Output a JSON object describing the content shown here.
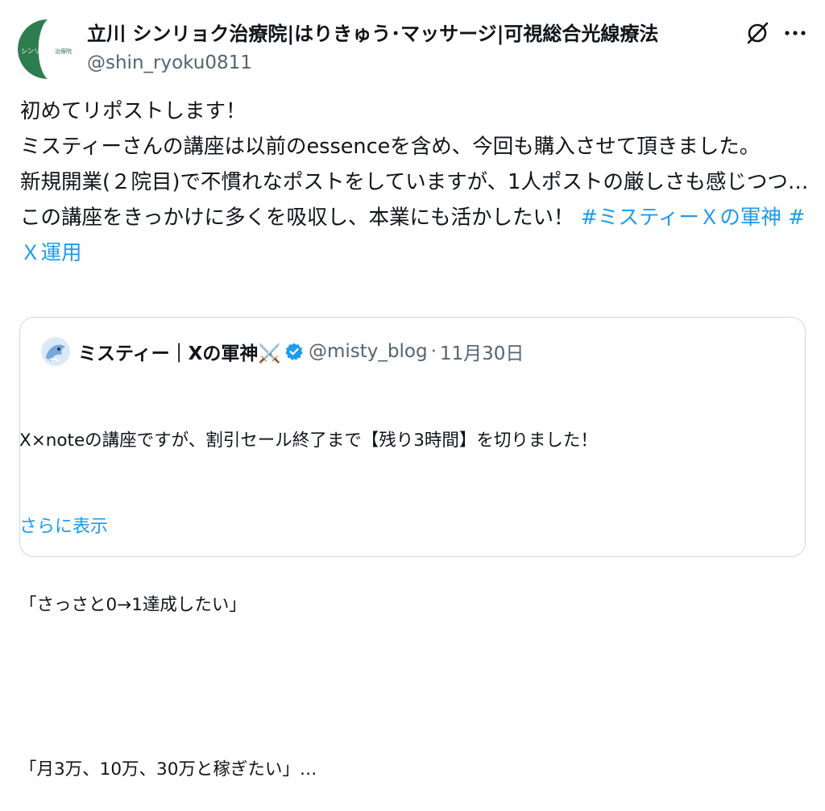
{
  "author": {
    "display_name": "立川 シンリョク治療院|はりきゅう･マッサージ|可視総合光線療法",
    "handle": "@shin_ryoku0811",
    "avatar_text": "シンリョク 治療院",
    "avatar_color": "#2e7d4f"
  },
  "post": {
    "text_main": "初めてリポストします！\nミスティーさんの講座は以前のessenceを含め、今回も購入させて頂きました。\n新規開業(２院目)で不慣れなポストをしていますが、1人ポストの厳しさも感じつつ…この講座をきっかけに多くを吸収し、本業にも活かしたい！ ",
    "hashtag_1": "#ミスティーＸの軍神",
    "hashtag_2": "#Ｘ運用"
  },
  "quote": {
    "display_name": "ミスティー｜Xの軍神⚔️",
    "handle": "@misty_blog",
    "separator": "·",
    "date": "11月30日",
    "lines": [
      "X×noteの講座ですが、割引セール終了まで【残り3時間】を切りました！",
      "「さっさと0→1達成したい」",
      "「月3万、10万、30万と稼ぎたい」…"
    ],
    "show_more": "さらに表示"
  },
  "colors": {
    "accent": "#1d9bf0",
    "muted": "#536471",
    "border": "#cfd9de"
  },
  "icons": {
    "grok": "grok-icon",
    "more": "more-icon",
    "verified": "verified-badge-icon"
  }
}
